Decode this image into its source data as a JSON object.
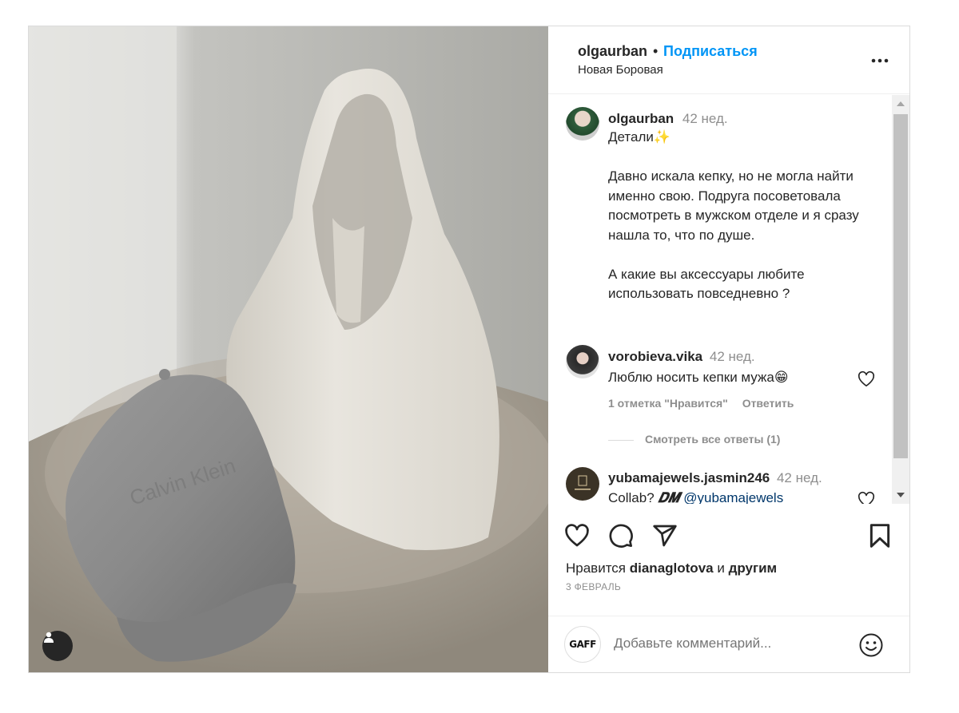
{
  "post": {
    "author": "olgaurban",
    "separator": "•",
    "follow_label": "Подписаться",
    "location": "Новая Боровая",
    "more_icon": "more-horizontal-icon"
  },
  "caption": {
    "username": "olgaurban",
    "time": "42 нед.",
    "title": "Детали",
    "title_emoji": "✨",
    "paragraph1": "Давно искала кепку, но не могла найти именно свою. Подруга посоветовала посмотреть в мужском отделе и я сразу нашла то, что по душе.",
    "paragraph2": "А какие вы аксессуары любите использовать повседневно ?"
  },
  "comments": [
    {
      "username": "vorobieva.vika",
      "time": "42 нед.",
      "text": "Люблю носить кепки мужа",
      "emoji": "😁",
      "likes_label": "1 отметка \"Нравится\"",
      "reply_label": "Ответить"
    },
    {
      "username": "yubamajewels.jasmin246",
      "time": "42 нед.",
      "text_prefix": "Collab?",
      "dm": "𝑫𝑴",
      "mention": "@yubamajewels"
    }
  ],
  "view_replies": "Смотреть все ответы (1)",
  "likes": {
    "prefix": "Нравится",
    "user": "dianaglotova",
    "conj": "и",
    "others": "другим"
  },
  "date": "3 ФЕВРАЛЬ",
  "add_comment": {
    "placeholder": "Добавьте комментарий...",
    "avatar_text": "GAFF"
  },
  "colors": {
    "follow_blue": "#0095f6",
    "mention_blue": "#00376b",
    "muted": "#8e8e8e"
  }
}
